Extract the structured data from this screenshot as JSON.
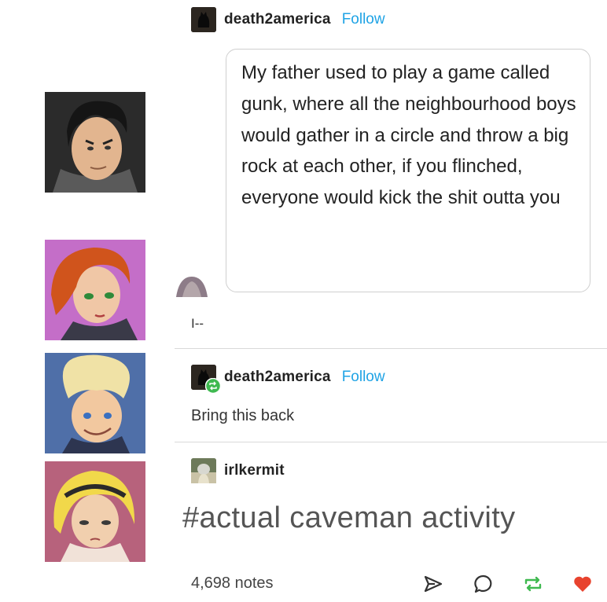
{
  "posts": [
    {
      "username": "death2america",
      "follow_label": "Follow",
      "quote": "My father used to play a game called gunk, where all the neighbourhood boys would gather in a circle and throw a big rock at each other, if you flinched, everyone would kick the shit outta you",
      "reply": "I--"
    },
    {
      "username": "death2america",
      "follow_label": "Follow",
      "text": "Bring this back"
    },
    {
      "username": "irlkermit",
      "tag": "#actual caveman activity"
    }
  ],
  "footer": {
    "notes": "4,698 notes"
  },
  "colors": {
    "follow": "#1fa3e5",
    "reblog": "#3fb950",
    "like": "#e8432e"
  },
  "icons": [
    "send-icon",
    "comment-icon",
    "reblog-icon",
    "heart-icon"
  ]
}
